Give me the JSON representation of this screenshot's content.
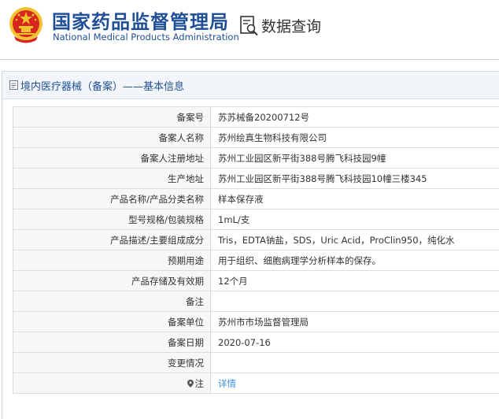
{
  "header": {
    "agency_cn": "国家药品监督管理局",
    "agency_en": "National Medical Products Administration",
    "query_title": "数据查询"
  },
  "panel": {
    "title": "境内医疗器械（备案）——基本信息"
  },
  "rows": [
    {
      "label": "备案号",
      "value": "苏苏械备20200712号"
    },
    {
      "label": "备案人名称",
      "value": "苏州绘真生物科技有限公司"
    },
    {
      "label": "备案人注册地址",
      "value": "苏州工业园区新平街388号腾飞科技园9幢"
    },
    {
      "label": "生产地址",
      "value": "苏州工业园区新平街388号腾飞科技园10幢三楼345"
    },
    {
      "label": "产品名称/产品分类名称",
      "value": "样本保存液"
    },
    {
      "label": "型号规格/包装规格",
      "value": "1mL/支"
    },
    {
      "label": "产品描述/主要组成成分",
      "value": "Tris，EDTA钠盐，SDS，Uric Acid，ProClin950，纯化水"
    },
    {
      "label": "预期用途",
      "value": "用于组织、细胞病理学分析样本的保存。"
    },
    {
      "label": "产品存储及有效期",
      "value": "12个月"
    },
    {
      "label": "备注",
      "value": ""
    },
    {
      "label": "备案单位",
      "value": "苏州市市场监督管理局"
    },
    {
      "label": "备案日期",
      "value": "2020-07-16"
    },
    {
      "label": "变更情况",
      "value": ""
    },
    {
      "label": "注",
      "value": "详情"
    }
  ],
  "colors": {
    "brand_blue": "#1f4f97",
    "link_blue": "#3a8ad8",
    "emblem_red": "#d7261e",
    "emblem_gold": "#f2c230"
  }
}
